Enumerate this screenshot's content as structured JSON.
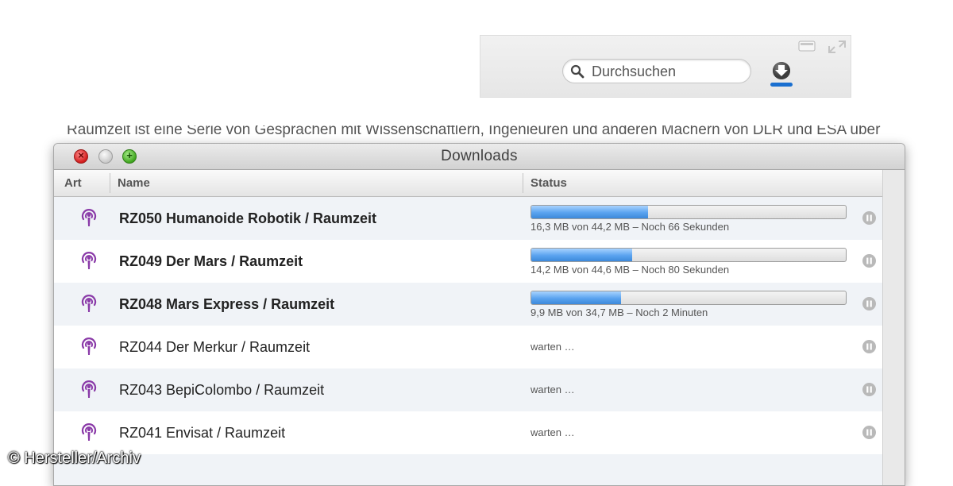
{
  "toolbar": {
    "search_placeholder": "Durchsuchen",
    "download_icon": "download-arrow-icon",
    "accent_color": "#1a6fd0"
  },
  "background_text": "Raumzeit ist eine Serie von Gesprächen mit Wissenschaftlern, Ingenieuren und anderen Machern von DLR und ESA über",
  "window": {
    "title": "Downloads",
    "columns": {
      "art": "Art",
      "name": "Name",
      "status": "Status"
    },
    "items": [
      {
        "name": "RZ050 Humanoide Robotik / Raumzeit",
        "active": true,
        "progress": 0.37,
        "status": "16,3 MB von 44,2 MB – Noch 66 Sekunden"
      },
      {
        "name": "RZ049 Der Mars / Raumzeit",
        "active": true,
        "progress": 0.32,
        "status": "14,2 MB von 44,6 MB – Noch 80 Sekunden"
      },
      {
        "name": "RZ048 Mars Express / Raumzeit",
        "active": true,
        "progress": 0.285,
        "status": "9,9 MB von 34,7 MB – Noch 2 Minuten"
      },
      {
        "name": "RZ044 Der Merkur / Raumzeit",
        "active": false,
        "status": "warten …"
      },
      {
        "name": "RZ043 BepiColombo / Raumzeit",
        "active": false,
        "status": "warten …"
      },
      {
        "name": "RZ041 Envisat / Raumzeit",
        "active": false,
        "status": "warten …"
      }
    ]
  },
  "copyright": "© Hersteller/Archiv"
}
